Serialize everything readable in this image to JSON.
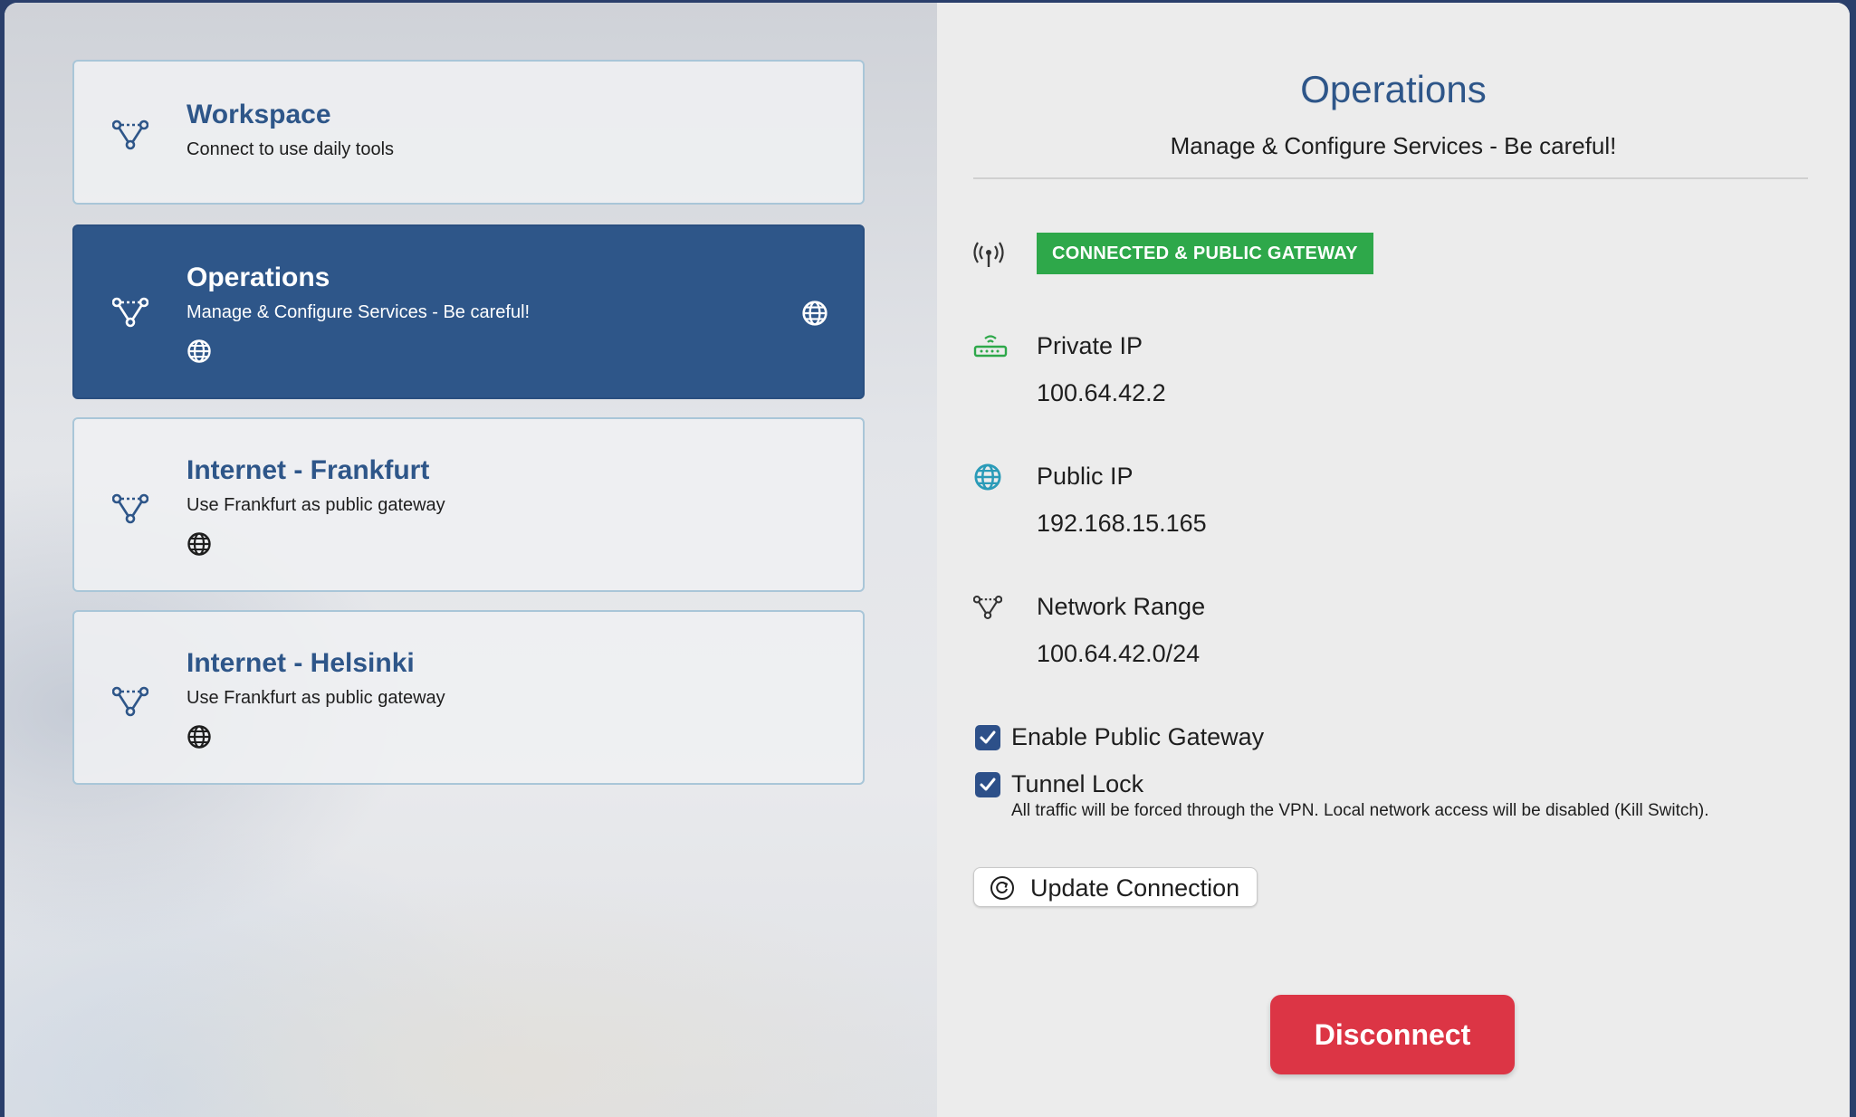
{
  "connections": [
    {
      "title": "Workspace",
      "subtitle": "Connect to use daily tools"
    },
    {
      "title": "Operations",
      "subtitle": "Manage & Configure Services - Be careful!"
    },
    {
      "title": "Internet - Frankfurt",
      "subtitle": "Use Frankfurt as public gateway"
    },
    {
      "title": "Internet - Helsinki",
      "subtitle": "Use Frankfurt as public gateway"
    }
  ],
  "detail": {
    "title": "Operations",
    "subtitle": "Manage & Configure Services - Be careful!",
    "status": "CONNECTED & PUBLIC GATEWAY",
    "private_ip_label": "Private IP",
    "private_ip": "100.64.42.2",
    "public_ip_label": "Public IP",
    "public_ip": "192.168.15.165",
    "network_range_label": "Network Range",
    "network_range": "100.64.42.0/24",
    "enable_gateway_label": "Enable Public Gateway",
    "enable_gateway_checked": true,
    "tunnel_lock_label": "Tunnel Lock",
    "tunnel_lock_checked": true,
    "tunnel_lock_help": "All traffic will be forced through the VPN. Local network access will be disabled (Kill Switch).",
    "update_button": "Update Connection",
    "disconnect_button": "Disconnect"
  },
  "icons": {
    "network": "network-topology-icon",
    "globe": "globe-icon",
    "antenna": "antenna-icon",
    "router": "router-icon",
    "refresh": "refresh-icon",
    "checkmark": "checkmark-icon"
  },
  "colors": {
    "accent": "#2e5689",
    "status_green": "#2ea84a",
    "danger": "#dc3545"
  }
}
